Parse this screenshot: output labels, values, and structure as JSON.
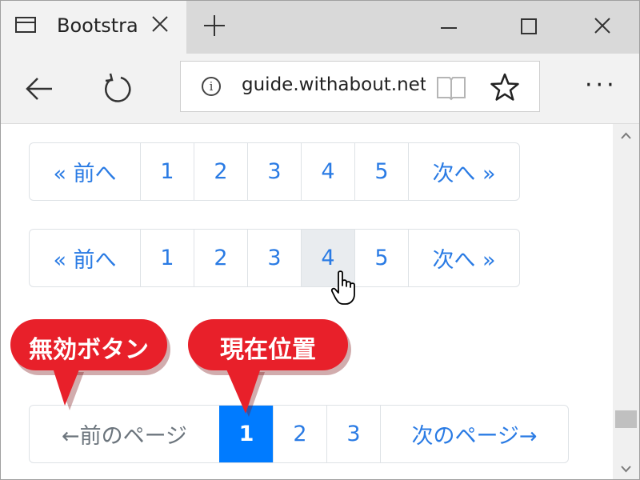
{
  "browser": {
    "tab_title": "Bootstra",
    "address": "guide.withabout.net"
  },
  "pagination1": {
    "items": [
      "« 前へ",
      "1",
      "2",
      "3",
      "4",
      "5",
      "次へ »"
    ]
  },
  "pagination2": {
    "items": [
      "« 前へ",
      "1",
      "2",
      "3",
      "4",
      "5",
      "次へ »"
    ],
    "hovered_index": 4
  },
  "pagination3": {
    "items": [
      "←前のページ",
      "1",
      "2",
      "3",
      "次のページ→"
    ],
    "disabled_index": 0,
    "active_index": 1
  },
  "callouts": {
    "disabled": "無効ボタン",
    "current": "現在位置"
  },
  "colors": {
    "link": "#2a7be4",
    "active": "#007bff",
    "disabled": "#6c757d",
    "hover_bg": "#e9ecef",
    "callout_red": "#e8202a"
  },
  "icons": {
    "tab": "page-icon",
    "close": "close-icon",
    "new_tab": "plus-icon",
    "back": "back-arrow-icon",
    "refresh": "refresh-icon",
    "info": "info-icon",
    "reading": "reading-view-icon",
    "favorite": "star-icon",
    "more": "more-icon",
    "cursor": "hand-cursor-icon"
  }
}
